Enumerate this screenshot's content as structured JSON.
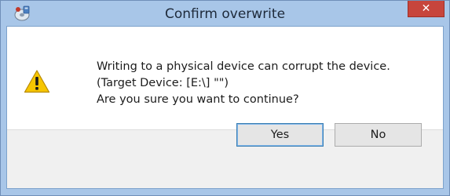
{
  "window": {
    "title": "Confirm overwrite",
    "app_icon": "disk-imager-icon",
    "close_glyph": "✕"
  },
  "message": {
    "icon": "warning-icon",
    "lines": [
      "Writing to a physical device can corrupt the device.",
      "(Target Device: [E:\\] \"\")",
      "Are you sure you want to continue?"
    ]
  },
  "buttons": {
    "yes_label": "Yes",
    "no_label": "No"
  },
  "colors": {
    "titlebar": "#a8c6e8",
    "close_button": "#c7453c",
    "footer": "#f0f0f0",
    "warning": "#f5c400"
  }
}
